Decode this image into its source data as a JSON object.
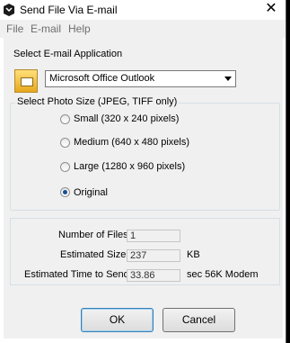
{
  "window": {
    "title": "Send File Via E-mail",
    "close_glyph": "✕"
  },
  "menu": [
    "File",
    "E-mail",
    "Help"
  ],
  "email_app": {
    "label": "Select E-mail Application",
    "selected": "Microsoft Office Outlook",
    "icon": "outlook-icon"
  },
  "photo_size": {
    "label": "Select Photo Size (JPEG, TIFF only)",
    "options": [
      "Small (320 x 240 pixels)",
      "Medium (640 x 480 pixels)",
      "Large (1280 x 960 pixels)",
      "Original"
    ],
    "selected_index": 3
  },
  "stats": {
    "num_files_label": "Number of Files:",
    "num_files": "1",
    "size_label": "Estimated Size:",
    "size": "237",
    "size_unit": "KB",
    "time_label": "Estimated Time to Send:",
    "time": "33.86",
    "time_unit": "sec 56K Modem"
  },
  "buttons": {
    "ok": "OK",
    "cancel": "Cancel"
  }
}
